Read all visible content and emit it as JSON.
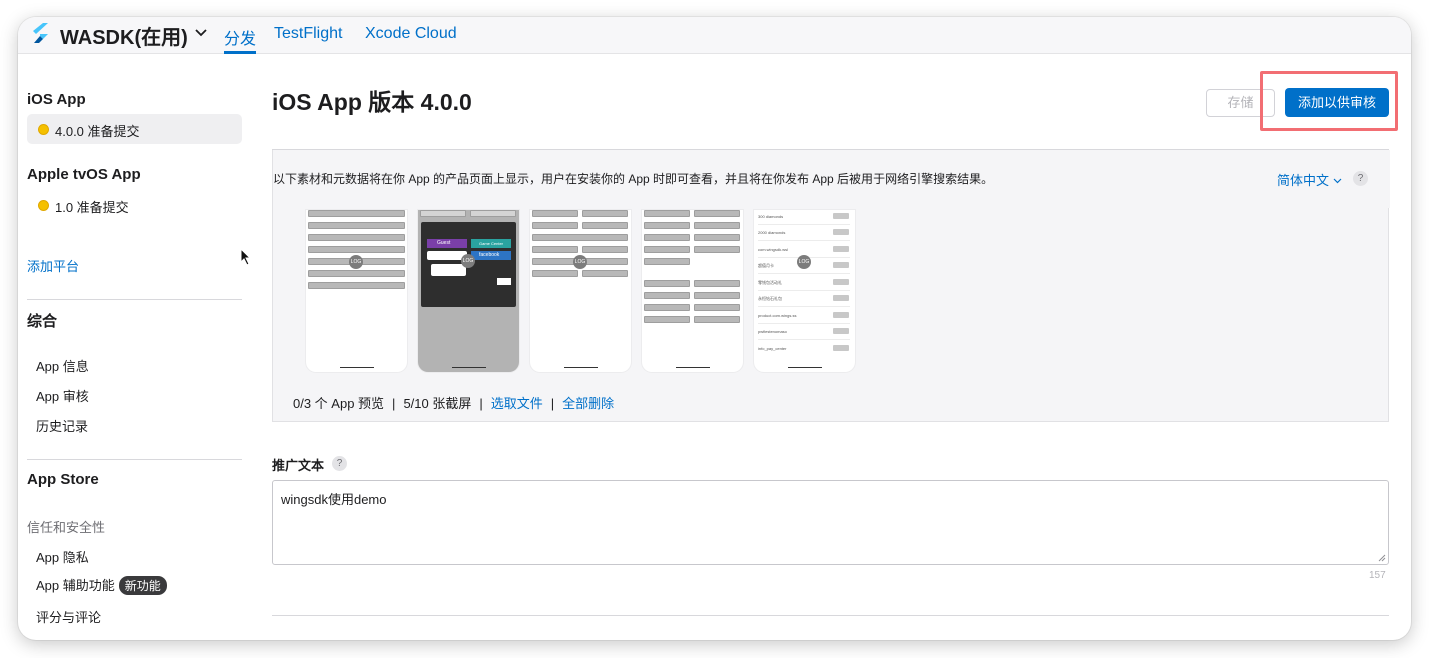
{
  "header": {
    "app_name": "WASDK(在用)",
    "tabs": [
      {
        "label": "分发",
        "active": true
      },
      {
        "label": "TestFlight",
        "active": false
      },
      {
        "label": "Xcode Cloud",
        "active": false
      }
    ]
  },
  "sidebar": {
    "ios_heading": "iOS App",
    "ios_version": "4.0.0 准备提交",
    "tvos_heading": "Apple tvOS App",
    "tvos_version": "1.0 准备提交",
    "add_platform": "添加平台",
    "general_heading": "综合",
    "general_items": [
      "App 信息",
      "App 审核",
      "历史记录"
    ],
    "store_heading": "App Store",
    "trust_heading": "信任和安全性",
    "privacy": "App 隐私",
    "accessibility": "App 辅助功能",
    "new_badge": "新功能",
    "ratings": "评分与评论"
  },
  "main": {
    "title": "iOS App 版本 4.0.0",
    "save_label": "存储",
    "submit_label": "添加以供审核",
    "description": "以下素材和元数据将在你 App 的产品页面上显示，用户在安装你的 App 时即可查看，并且将在你发布 App 后被用于网络引擎搜索结果。",
    "language": "简体中文",
    "help": "?",
    "media_counts": {
      "previews": "0/3 个 App 预览",
      "screenshots": "5/10 张截屏",
      "choose_files": "选取文件",
      "delete_all": "全部删除"
    },
    "promo_label": "推广文本",
    "promo_value": "wingsdk使用demo",
    "char_count": "157"
  },
  "screenshots": {
    "log_label": "LOG",
    "shot2": {
      "guest": "Guest",
      "game_center": "Game Center",
      "facebook": "facebook"
    },
    "shot5_rows": [
      "300 diamonds",
      "2000 diamonds",
      "com.wingsdk.wsl",
      "超值月卡",
      "零钱包活动礼",
      "永恒钻石礼包",
      "product.com.wings.ss",
      "pwfiestenomaso",
      "info_pay_center"
    ],
    "buy_label": "buy"
  },
  "colors": {
    "accent": "#0070c9",
    "highlight": "#f26e73",
    "pending_dot": "#f5c000"
  }
}
